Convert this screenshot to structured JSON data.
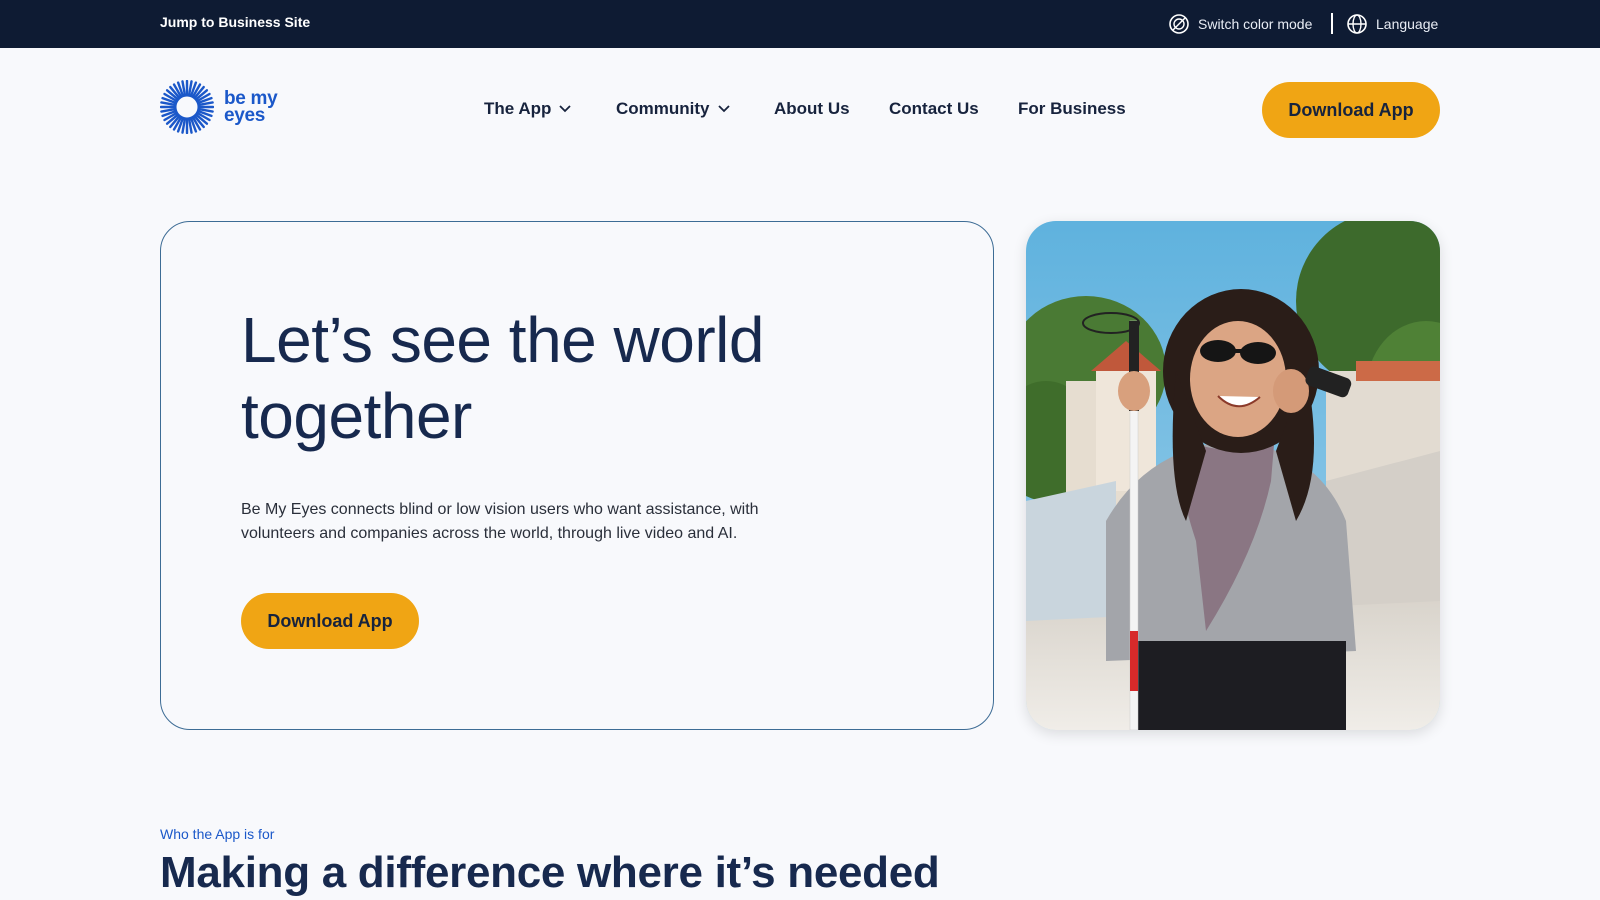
{
  "topbar": {
    "jump_link": "Jump to Business Site",
    "color_mode": "Switch color mode",
    "language": "Language"
  },
  "brand": {
    "logo_line1": "be my",
    "logo_line2": "eyes",
    "color": "#1b58c9"
  },
  "nav": {
    "items": [
      {
        "label": "The App",
        "has_dropdown": true
      },
      {
        "label": "Community",
        "has_dropdown": true
      },
      {
        "label": "About Us",
        "has_dropdown": false
      },
      {
        "label": "Contact Us",
        "has_dropdown": false
      },
      {
        "label": "For Business",
        "has_dropdown": false
      }
    ],
    "download_label": "Download App"
  },
  "hero": {
    "title": "Let’s see the world together",
    "description": "Be My Eyes connects blind or low vision users who want assistance, with volunteers and companies across the world, through live video and AI.",
    "download_label": "Download App",
    "image_alt": "Smiling woman with sunglasses and a white cane holding a phone to her ear"
  },
  "section": {
    "eyebrow": "Who the App is for",
    "title": "Making a difference where it’s needed"
  },
  "colors": {
    "topbar_bg": "#0e1b33",
    "accent_button": "#f0a514",
    "heading": "#17294e",
    "card_border": "#3d6c95"
  },
  "icons": {
    "color_mode": "color-mode-icon",
    "language": "globe-icon",
    "dropdown": "chevron-down-icon",
    "logo": "sunburst-logo-icon"
  }
}
